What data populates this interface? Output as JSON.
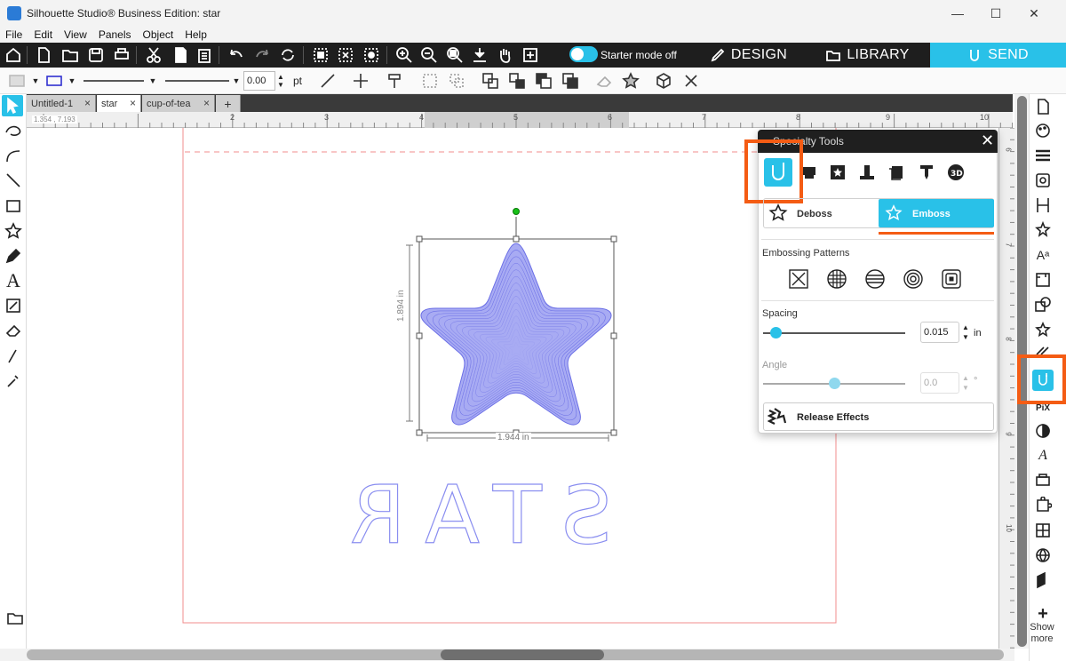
{
  "window": {
    "title": "Silhouette Studio® Business Edition: star",
    "controls": {
      "minimize": "—",
      "maximize": "☐",
      "close": "✕"
    }
  },
  "menu": [
    "File",
    "Edit",
    "View",
    "Panels",
    "Object",
    "Help"
  ],
  "toolbar": {
    "starter_mode_label": "Starter mode off",
    "modes": {
      "design": "DESIGN",
      "library": "LIBRARY",
      "send": "SEND"
    }
  },
  "properties": {
    "line_width": "0.00",
    "unit": "pt"
  },
  "doc_tabs": [
    {
      "label": "Untitled-1",
      "close": "×"
    },
    {
      "label": "star",
      "close": "×"
    },
    {
      "label": "cup-of-tea",
      "close": "×"
    }
  ],
  "add_tab": "+",
  "ruler": {
    "coords": "1.354 , 7.193",
    "h_ticks": [
      "2",
      "3",
      "4",
      "5",
      "6",
      "7",
      "8",
      "9",
      "10"
    ],
    "v_ticks": [
      "6",
      "7",
      "8",
      "9",
      "10"
    ]
  },
  "selection": {
    "width": "1.944 in",
    "height": "1.894 in"
  },
  "canvas_text": "STAR",
  "colors": {
    "accent": "#29c1e8",
    "highlight": "#f45c14",
    "star_fill": "#9fa2f2",
    "star_line": "#6a6ee6",
    "cut_line": "#f28c8c"
  },
  "specialty_panel": {
    "title": "Specialty Tools",
    "close": "✕",
    "deboss_label": "Deboss",
    "emboss_label": "Emboss",
    "patterns_label": "Embossing Patterns",
    "spacing_label": "Spacing",
    "spacing_value": "0.015",
    "spacing_unit": "in",
    "spacing_level": 0.09,
    "angle_label": "Angle",
    "angle_value": "0.0",
    "angle_unit": "°",
    "angle_level": 0.5,
    "release_label": "Release Effects"
  },
  "right_panel": {
    "show_more": "Show more"
  }
}
